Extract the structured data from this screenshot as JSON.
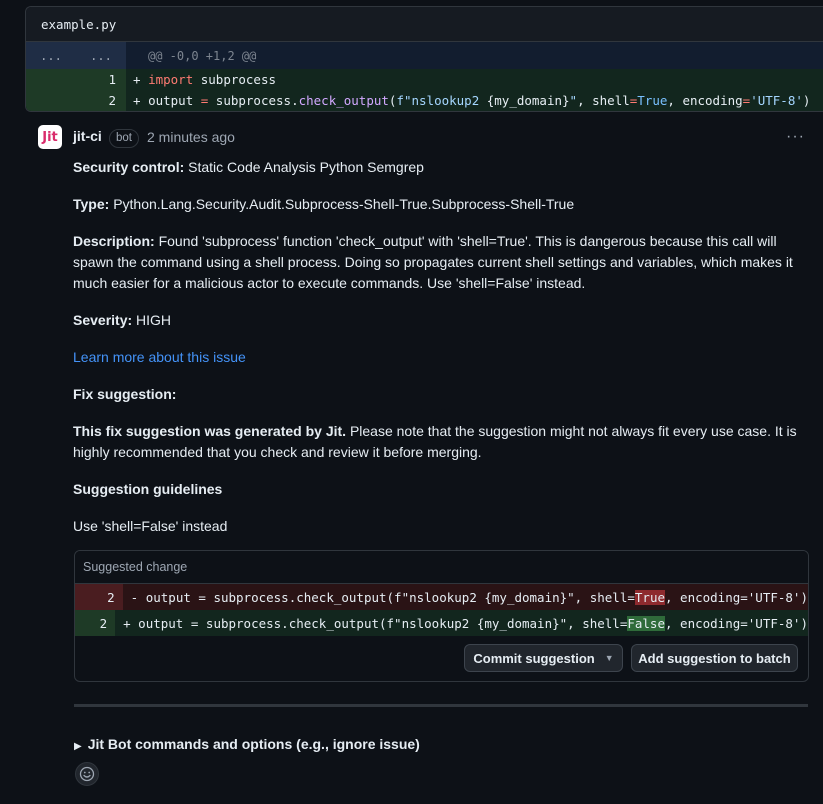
{
  "file": {
    "name": "example.py",
    "hunk_left": "...",
    "hunk_right": "...",
    "hunk_header": "@@ -0,0 +1,2 @@",
    "lines": [
      {
        "num": "1",
        "sign": "+",
        "tokens": [
          {
            "t": "import",
            "c": "kw"
          },
          {
            "t": " subprocess",
            "c": ""
          }
        ]
      },
      {
        "num": "2",
        "sign": "+",
        "tokens": [
          {
            "t": "output ",
            "c": ""
          },
          {
            "t": "=",
            "c": "op"
          },
          {
            "t": " subprocess.",
            "c": ""
          },
          {
            "t": "check_output",
            "c": "fn"
          },
          {
            "t": "(",
            "c": ""
          },
          {
            "t": "f\"nslookup2 ",
            "c": "str"
          },
          {
            "t": "{my_domain}",
            "c": ""
          },
          {
            "t": "\"",
            "c": "str"
          },
          {
            "t": ", shell",
            "c": ""
          },
          {
            "t": "=",
            "c": "op"
          },
          {
            "t": "True",
            "c": "const"
          },
          {
            "t": ", encoding",
            "c": ""
          },
          {
            "t": "=",
            "c": "op"
          },
          {
            "t": "'UTF-8'",
            "c": "str"
          },
          {
            "t": ")",
            "c": ""
          }
        ]
      }
    ]
  },
  "comment": {
    "avatar_text": "Jit",
    "author": "jit-ci",
    "badge": "bot",
    "time": "2 minutes ago",
    "more": "···",
    "security_label": "Security control:",
    "security_value": " Static Code Analysis Python Semgrep",
    "type_label": "Type:",
    "type_value": " Python.Lang.Security.Audit.Subprocess-Shell-True.Subprocess-Shell-True",
    "desc_label": "Description:",
    "desc_value": " Found 'subprocess' function 'check_output' with 'shell=True'. This is dangerous because this call will spawn the command using a shell process. Doing so propagates current shell settings and variables, which makes it much easier for a malicious actor to execute commands. Use 'shell=False' instead.",
    "severity_label": "Severity:",
    "severity_value": " HIGH",
    "learn_link": "Learn more about this issue",
    "fix_heading": "Fix suggestion:",
    "fix_note_bold": "This fix suggestion was generated by Jit.",
    "fix_note": " Please note that the suggestion might not always fit every use case. It is highly recommended that you check and review it before merging.",
    "guidelines_heading": "Suggestion guidelines",
    "guidelines_text": "Use 'shell=False' instead"
  },
  "suggestion": {
    "header": "Suggested change",
    "del_num": "2",
    "del_sign": "-",
    "del_pre": " output = subprocess.check_output(f\"nslookup2 {my_domain}\", shell=",
    "del_hl": "True",
    "del_post": ", encoding='UTF-8')",
    "add_num": "2",
    "add_sign": "+",
    "add_pre": " output = subprocess.check_output(f\"nslookup2 {my_domain}\", shell=",
    "add_hl": "False",
    "add_post": ", encoding='UTF-8')",
    "commit_label": "Commit suggestion",
    "batch_label": "Add suggestion to batch"
  },
  "footer": {
    "details_label": "Jit Bot commands and options (e.g., ignore issue)"
  }
}
